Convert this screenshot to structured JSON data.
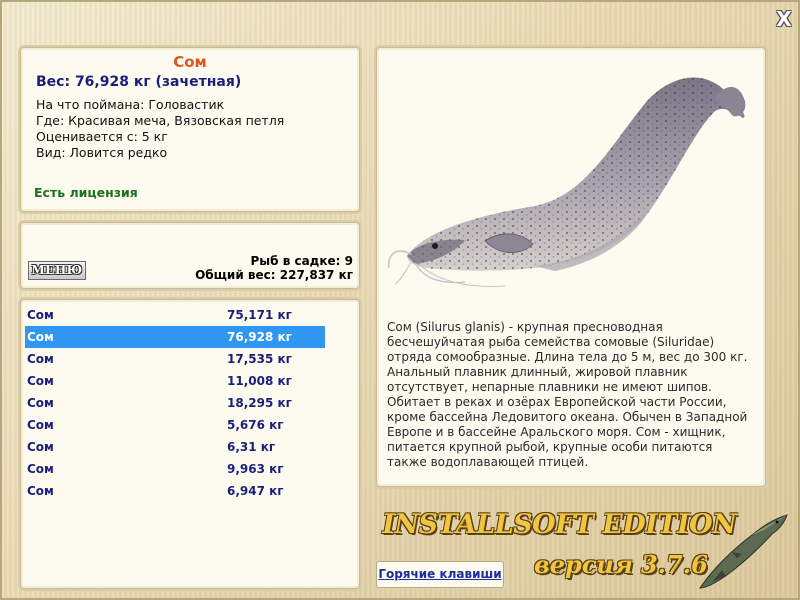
{
  "window": {
    "close_symbol": "X",
    "close_icon": "close-icon"
  },
  "fish_info": {
    "name": "Сом",
    "weight": "Вес: 76,928 кг (зачетная)",
    "bait": "На что поймана: Головастик",
    "location": "Где: Красивая меча, Вязовская петля",
    "min_weight": "Оценивается с: 5 кг",
    "rarity": "Вид: Ловится редко",
    "license": "Есть лицензия"
  },
  "keepnet": {
    "menu_label": "МЕНЮ",
    "fish_count": "Рыб в садке: 9",
    "total_weight": "Общий вес: 227,837 кг"
  },
  "catch_list": [
    {
      "name": "Сом",
      "weight": "75,171 кг"
    },
    {
      "name": "Сом",
      "weight": "76,928 кг"
    },
    {
      "name": "Сом",
      "weight": "17,535 кг"
    },
    {
      "name": "Сом",
      "weight": "11,008 кг"
    },
    {
      "name": "Сом",
      "weight": "18,295 кг"
    },
    {
      "name": "Сом",
      "weight": "5,676 кг"
    },
    {
      "name": "Сом",
      "weight": "6,31 кг"
    },
    {
      "name": "Сом",
      "weight": "9,963 кг"
    },
    {
      "name": "Сом",
      "weight": "6,947 кг"
    }
  ],
  "selected_index": 1,
  "description": "Сом (Silurus glanis) - крупная пресноводная бесчешуйчатая рыба семейства сомовые (Siluridae) отряда сомообразные. Длина тела до 5 м, вес до 300 кг. Анальный плавник длинный, жировой плавник отсутствует, непарные плавники не имеют шипов. Обитает в реках и озёрах Европейской части России, кроме бассейна Ледовитого океана. Обычен в Западной Европе и в бассейне Аральского моря. Сом - хищник, питается крупной рыбой, крупные особи питаются также водоплавающей птицей.",
  "hotkeys_label": "Горячие клавиши",
  "logo": {
    "title": "INSTALLSOFT EDITION",
    "version_word": "версия",
    "version_number": "3.7.6"
  },
  "colors": {
    "background": "#e8dcb9",
    "title_orange": "#d85a1f",
    "text_navy": "#1a1f7a",
    "license_green": "#1e6f1e",
    "selection_blue": "#2f97f2",
    "logo_gold": "#f0c53f"
  }
}
